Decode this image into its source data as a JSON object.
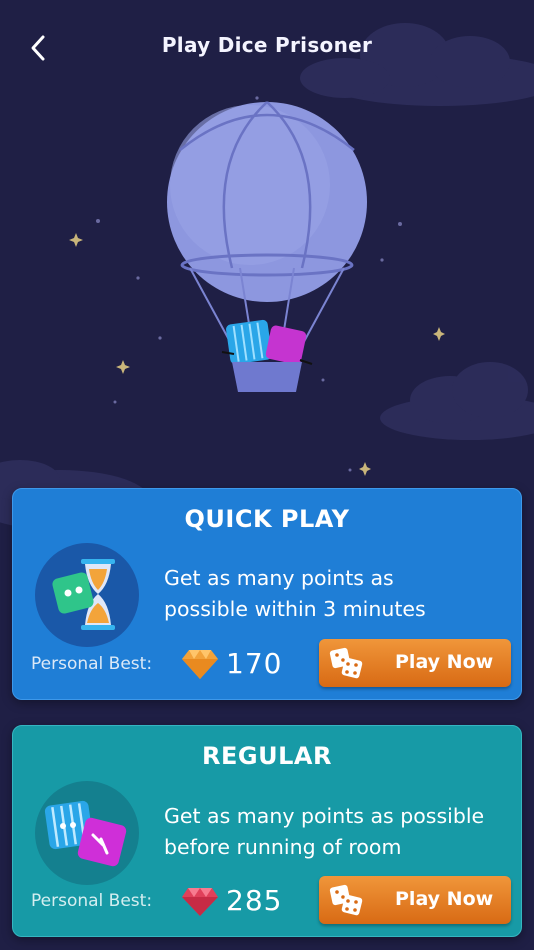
{
  "header": {
    "title": "Play Dice Prisoner",
    "back_icon": "chevron-left-icon"
  },
  "colors": {
    "background": "#1f1f45",
    "quick_card": "#1f7ed6",
    "regular_card": "#179aa6",
    "play_button": "#e5801f"
  },
  "modes": [
    {
      "title": "QUICK PLAY",
      "description_line1": "Get as many points as",
      "description_line2": "possible within 3 minutes",
      "best_label": "Personal Best:",
      "best_score": "170",
      "gem_icon": "orange-diamond-icon",
      "mode_icon": "hourglass-dice-icon",
      "button_label": "Play Now",
      "button_icon": "dice-icon"
    },
    {
      "title": "REGULAR",
      "description_line1": "Get as many points as possible",
      "description_line2": "before running of room",
      "best_label": "Personal Best:",
      "best_score": "285",
      "gem_icon": "red-gem-icon",
      "mode_icon": "caged-dice-icon",
      "button_label": "Play Now",
      "button_icon": "dice-icon"
    }
  ]
}
